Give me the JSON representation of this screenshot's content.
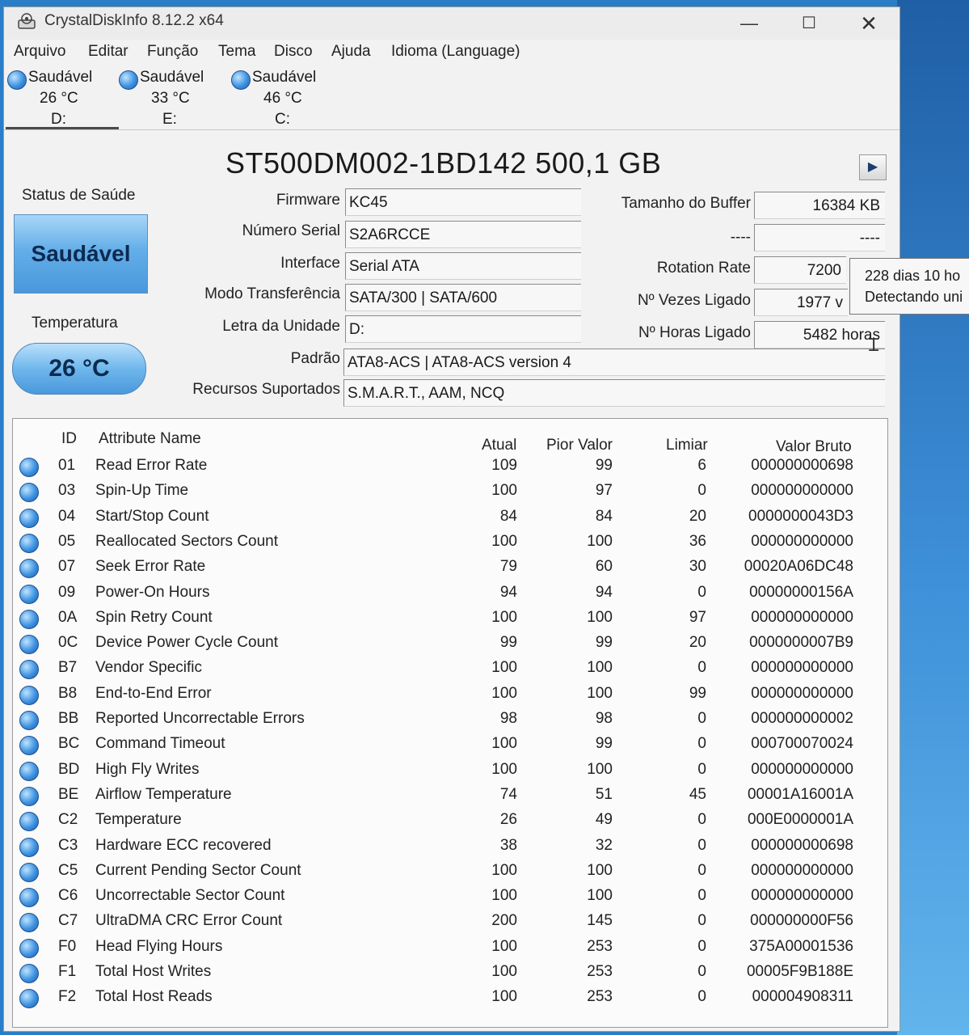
{
  "window": {
    "title": "CrystalDiskInfo 8.12.2 x64",
    "minimize": "—",
    "maximize": "☐",
    "close": "✕"
  },
  "menu": [
    "Arquivo",
    "Editar",
    "Função",
    "Tema",
    "Disco",
    "Ajuda",
    "Idioma (Language)"
  ],
  "drives": [
    {
      "status": "Saudável",
      "temp": "26 °C",
      "letter": "D:"
    },
    {
      "status": "Saudável",
      "temp": "33 °C",
      "letter": "E:"
    },
    {
      "status": "Saudável",
      "temp": "46 °C",
      "letter": "C:"
    }
  ],
  "model": "ST500DM002-1BD142 500,1 GB",
  "health": {
    "label": "Status de Saúde",
    "value": "Saudável",
    "temp_label": "Temperatura",
    "temp_value": "26 °C"
  },
  "info": {
    "firmware_label": "Firmware",
    "firmware": "KC45",
    "serial_label": "Número Serial",
    "serial": "S2A6RCCE",
    "interface_label": "Interface",
    "interface": "Serial ATA",
    "transfer_label": "Modo Transferência",
    "transfer": "SATA/300 | SATA/600",
    "drive_letter_label": "Letra da Unidade",
    "drive_letter": "D:",
    "standard_label": "Padrão",
    "standard": "ATA8-ACS | ATA8-ACS version 4",
    "features_label": "Recursos Suportados",
    "features": "S.M.A.R.T., AAM, NCQ",
    "buffer_label": "Tamanho do Buffer",
    "buffer": "16384 KB",
    "blank_label": "----",
    "blank_value": "----",
    "rotation_label": "Rotation Rate",
    "rotation": "7200",
    "power_count_label": "Nº Vezes Ligado",
    "power_count": "1977 v",
    "power_hours_label": "Nº Horas Ligado",
    "power_hours": "5482 horas"
  },
  "tooltip": {
    "line1": "228 dias 10 ho",
    "line2": "Detectando uni"
  },
  "table": {
    "headers": {
      "id": "ID",
      "name": "Attribute Name",
      "current": "Atual",
      "worst": "Pior Valor",
      "threshold": "Limiar",
      "raw": "Valor Bruto"
    },
    "rows": [
      {
        "id": "01",
        "name": "Read Error Rate",
        "current": "109",
        "worst": "99",
        "threshold": "6",
        "raw": "000000000698"
      },
      {
        "id": "03",
        "name": "Spin-Up Time",
        "current": "100",
        "worst": "97",
        "threshold": "0",
        "raw": "000000000000"
      },
      {
        "id": "04",
        "name": "Start/Stop Count",
        "current": "84",
        "worst": "84",
        "threshold": "20",
        "raw": "0000000043D3"
      },
      {
        "id": "05",
        "name": "Reallocated Sectors Count",
        "current": "100",
        "worst": "100",
        "threshold": "36",
        "raw": "000000000000"
      },
      {
        "id": "07",
        "name": "Seek Error Rate",
        "current": "79",
        "worst": "60",
        "threshold": "30",
        "raw": "00020A06DC48"
      },
      {
        "id": "09",
        "name": "Power-On Hours",
        "current": "94",
        "worst": "94",
        "threshold": "0",
        "raw": "00000000156A"
      },
      {
        "id": "0A",
        "name": "Spin Retry Count",
        "current": "100",
        "worst": "100",
        "threshold": "97",
        "raw": "000000000000"
      },
      {
        "id": "0C",
        "name": "Device Power Cycle Count",
        "current": "99",
        "worst": "99",
        "threshold": "20",
        "raw": "0000000007B9"
      },
      {
        "id": "B7",
        "name": "Vendor Specific",
        "current": "100",
        "worst": "100",
        "threshold": "0",
        "raw": "000000000000"
      },
      {
        "id": "B8",
        "name": "End-to-End Error",
        "current": "100",
        "worst": "100",
        "threshold": "99",
        "raw": "000000000000"
      },
      {
        "id": "BB",
        "name": "Reported Uncorrectable Errors",
        "current": "98",
        "worst": "98",
        "threshold": "0",
        "raw": "000000000002"
      },
      {
        "id": "BC",
        "name": "Command Timeout",
        "current": "100",
        "worst": "99",
        "threshold": "0",
        "raw": "000700070024"
      },
      {
        "id": "BD",
        "name": "High Fly Writes",
        "current": "100",
        "worst": "100",
        "threshold": "0",
        "raw": "000000000000"
      },
      {
        "id": "BE",
        "name": "Airflow Temperature",
        "current": "74",
        "worst": "51",
        "threshold": "45",
        "raw": "00001A16001A"
      },
      {
        "id": "C2",
        "name": "Temperature",
        "current": "26",
        "worst": "49",
        "threshold": "0",
        "raw": "000E0000001A"
      },
      {
        "id": "C3",
        "name": "Hardware ECC recovered",
        "current": "38",
        "worst": "32",
        "threshold": "0",
        "raw": "000000000698"
      },
      {
        "id": "C5",
        "name": "Current Pending Sector Count",
        "current": "100",
        "worst": "100",
        "threshold": "0",
        "raw": "000000000000"
      },
      {
        "id": "C6",
        "name": "Uncorrectable Sector Count",
        "current": "100",
        "worst": "100",
        "threshold": "0",
        "raw": "000000000000"
      },
      {
        "id": "C7",
        "name": "UltraDMA CRC Error Count",
        "current": "200",
        "worst": "145",
        "threshold": "0",
        "raw": "000000000F56"
      },
      {
        "id": "F0",
        "name": "Head Flying Hours",
        "current": "100",
        "worst": "253",
        "threshold": "0",
        "raw": "375A00001536"
      },
      {
        "id": "F1",
        "name": "Total Host Writes",
        "current": "100",
        "worst": "253",
        "threshold": "0",
        "raw": "00005F9B188E"
      },
      {
        "id": "F2",
        "name": "Total Host Reads",
        "current": "100",
        "worst": "253",
        "threshold": "0",
        "raw": "000004908311"
      }
    ]
  }
}
